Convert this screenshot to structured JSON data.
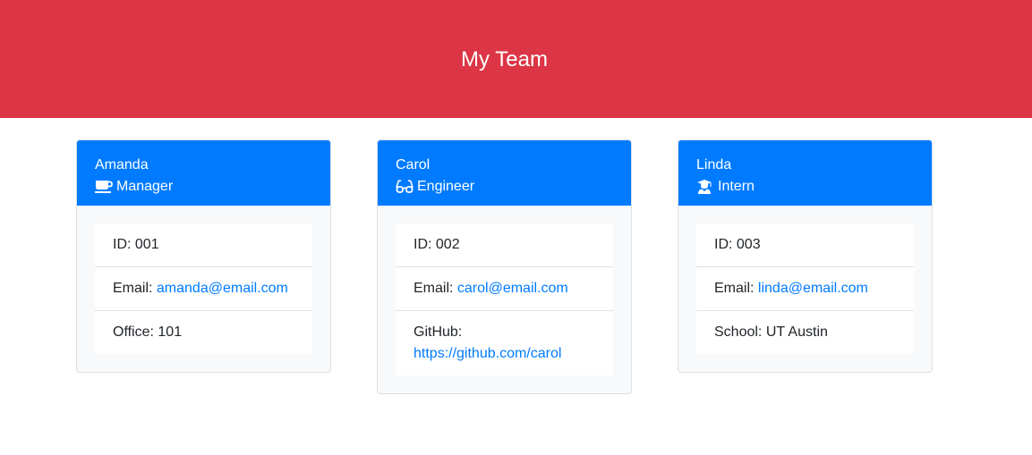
{
  "header": {
    "title": "My Team"
  },
  "colors": {
    "header_bg": "#dc3545",
    "card_header_bg": "#007bff",
    "link": "#007bff"
  },
  "cards": [
    {
      "name": "Amanda",
      "role": "Manager",
      "role_icon": "coffee-icon",
      "id_label": "ID:",
      "id": "001",
      "email_label": "Email:",
      "email": "amanda@email.com",
      "extra_label": "Office:",
      "extra": "101"
    },
    {
      "name": "Carol",
      "role": "Engineer",
      "role_icon": "glasses-icon",
      "id_label": "ID:",
      "id": "002",
      "email_label": "Email:",
      "email": "carol@email.com",
      "extra_label": "GitHub:",
      "extra": "https://github.com/carol"
    },
    {
      "name": "Linda",
      "role": "Intern",
      "role_icon": "graduate-icon",
      "id_label": "ID:",
      "id": "003",
      "email_label": "Email:",
      "email": "linda@email.com",
      "extra_label": "School:",
      "extra": "UT Austin"
    }
  ]
}
